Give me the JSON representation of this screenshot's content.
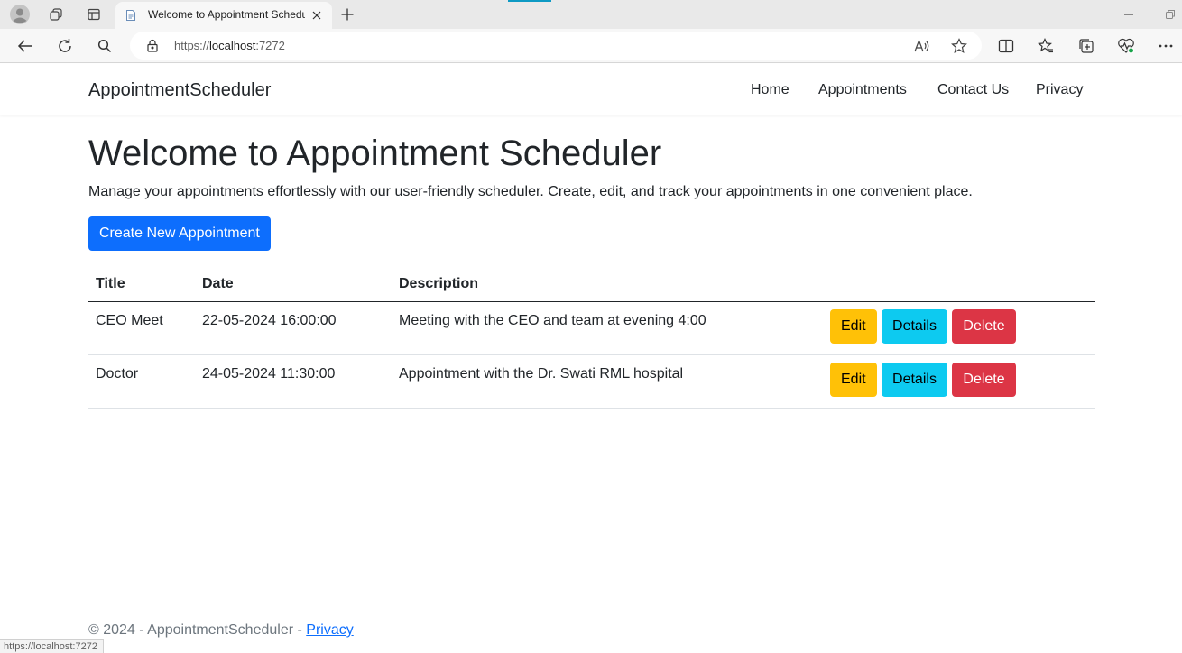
{
  "browser": {
    "tab_title": "Welcome to Appointment Scheduler",
    "url_prefix": "https://",
    "url_host": "localhost",
    "url_suffix": ":7272",
    "status_url": "https://localhost:7272"
  },
  "navbar": {
    "brand": "AppointmentScheduler",
    "links": [
      "Home",
      "Appointments",
      "Contact Us",
      "Privacy"
    ]
  },
  "main": {
    "title": "Welcome to Appointment Scheduler",
    "lead": "Manage your appointments effortlessly with our user-friendly scheduler. Create, edit, and track your appointments in one convenient place.",
    "create_button": "Create New Appointment"
  },
  "table": {
    "headers": [
      "Title",
      "Date",
      "Description"
    ],
    "rows": [
      {
        "title": "CEO Meet",
        "date": "22-05-2024 16:00:00",
        "description": "Meeting with the CEO and team at evening 4:00"
      },
      {
        "title": "Doctor",
        "date": "24-05-2024 11:30:00",
        "description": "Appointment with the Dr. Swati RML hospital"
      }
    ],
    "actions": {
      "edit": "Edit",
      "details": "Details",
      "delete": "Delete"
    }
  },
  "footer": {
    "text": "© 2024 - AppointmentScheduler - ",
    "privacy_link": "Privacy"
  },
  "colors": {
    "primary": "#0d6efd",
    "warning": "#ffc107",
    "info": "#0dcaf0",
    "danger": "#dc3545"
  }
}
